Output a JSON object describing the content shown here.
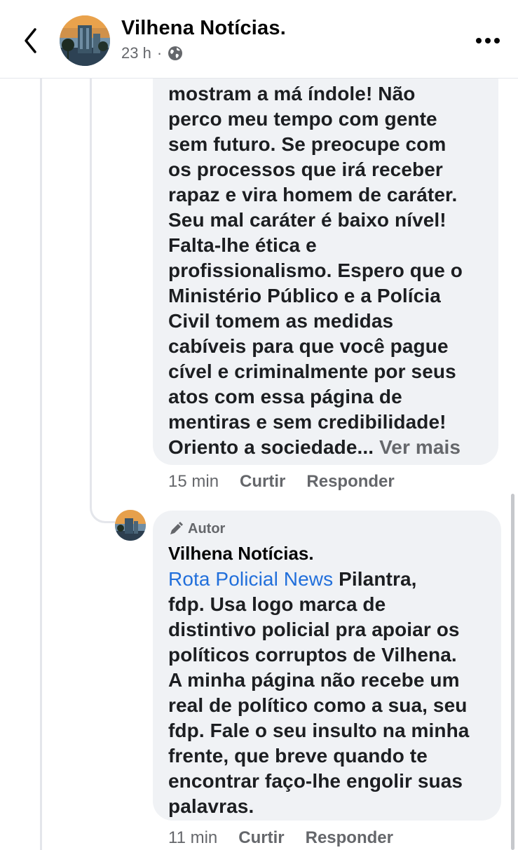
{
  "header": {
    "title": "Vilhena Notícias.",
    "time": "23 h",
    "separator": "·",
    "back_icon": "chevron-left-icon",
    "privacy_icon": "globe-icon",
    "more_icon": "more-horizontal-icon"
  },
  "comment1": {
    "lines": [
      "mostram a má índole! Não",
      "perco meu tempo com gente",
      "sem futuro. Se preocupe com",
      "os processos que irá receber",
      "rapaz e vira homem de caráter.",
      "Seu mal caráter é baixo nível!",
      "Falta-lhe ética e",
      "profissionalismo. Espero que o",
      "Ministério Público e a Polícia",
      "Civil tomem as medidas",
      "cabíveis para que você pague",
      "cível e criminalmente por seus",
      "atos com essa página de",
      "mentiras e sem credibilidade!"
    ],
    "last_line": "Orientoa sociedade...",
    "last_line_text": "Oriento a sociedade...",
    "see_more": "Ver mais",
    "time": "15 min",
    "like": "Curtir",
    "reply": "Responder"
  },
  "comment2": {
    "badge": "Autor",
    "name": "Vilhena Notícias.",
    "mention": "Rota Policial News",
    "first_line_rest": " Pilantra,",
    "lines": [
      "fdp. Usa logo marca de",
      "distintivo policial pra apoiar os",
      "políticos corruptos de Vilhena.",
      "A minha página não recebe um",
      "real de político como a sua, seu",
      "fdp. Fale o seu insulto na minha",
      "frente, que breve quando te",
      "encontrar faço-lhe engolir suas",
      "palavras."
    ],
    "time": "11 min",
    "like": "Curtir",
    "reply": "Responder"
  },
  "colors": {
    "link": "#216fdb",
    "secondary_text": "#65676b",
    "bubble": "#f0f2f5"
  }
}
